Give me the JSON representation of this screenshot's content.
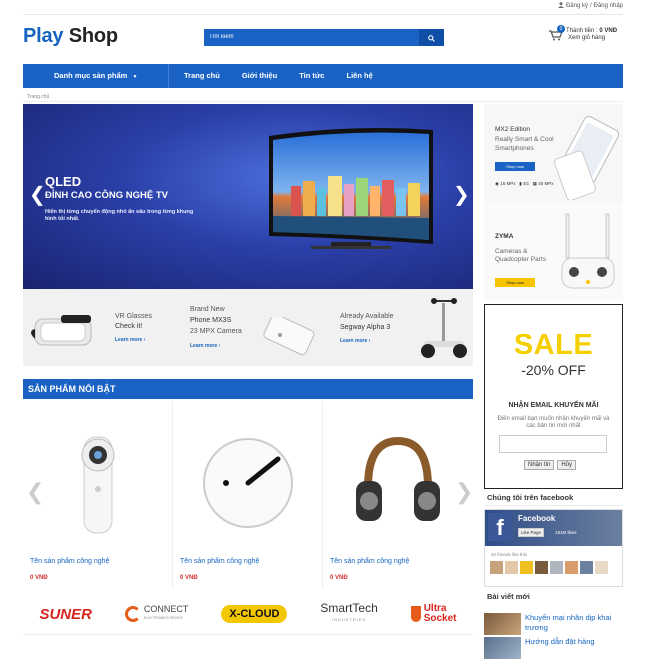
{
  "topbar": {
    "register": "Đăng ký",
    "separator": "/",
    "login": "Đăng nhập"
  },
  "logo": {
    "part1": "Play",
    "part2": "Shop"
  },
  "search": {
    "placeholder": "Tìm kiếm"
  },
  "cart": {
    "count": "0",
    "label": "Thành tiền :",
    "amount": "0 VNĐ",
    "view": "Xem giỏ hàng"
  },
  "nav": {
    "category": "Danh mục sản phẩm",
    "items": [
      "Trang chủ",
      "Giới thiệu",
      "Tin tức",
      "Liên hệ"
    ]
  },
  "breadcrumb": "Trang chủ",
  "hero": {
    "title": "QLED",
    "subtitle": "ĐỈNH CAO CÔNG NGHỆ TV",
    "desc": "Hiển thị từng chuyển động nhỏ ẩn sâu trong từng khung hình tối nhất.",
    "prev": "❮",
    "next": "❯"
  },
  "banners": [
    {
      "line1": "VR Glasses",
      "line2": "Check it!",
      "more": "Learn more ›"
    },
    {
      "line1": "Brand New",
      "line2": "Phone MX3S",
      "line3": "23 MPX Camera",
      "more": "Learn more ›"
    },
    {
      "line1": "Already Available",
      "line2": "Segway Alpha 3",
      "more": "Learn more ›"
    }
  ],
  "right_banners": [
    {
      "line1": "MX2 Edition",
      "line2": "Really Smart & Cool",
      "line3": "Smartphones",
      "button": "Shop now",
      "stat1": "16 MPx",
      "stat2": "4G",
      "stat3": "40 MPx"
    },
    {
      "line1": "ZYMA",
      "line2": "Cameras & Quadcopter Parts",
      "button": "Shop now"
    }
  ],
  "sale": {
    "big": "SALE",
    "percent": "-20% OFF",
    "heading": "NHẬN EMAIL KHUYẾN MÃI",
    "text": "Điền email bạn muốn nhận khuyến mãi và các bản tin mới nhất",
    "submit": "Nhận tin",
    "cancel": "Hủy"
  },
  "facebook": {
    "heading": "Chúng tôi trên facebook",
    "page_name": "Facebook",
    "like_button": "Like Page",
    "likes": "191M likes",
    "friends": "40 friends like this"
  },
  "posts": {
    "heading": "Bài viết mới",
    "items": [
      "Khuyến mại nhân dịp khai trương",
      "Hướng dẫn đặt hàng"
    ]
  },
  "featured": {
    "heading": "SẢN PHẨM NỔI BẬT",
    "products": [
      {
        "name": "Tên sản phẩm công nghệ",
        "price": "0 VNĐ"
      },
      {
        "name": "Tên sản phẩm công nghệ",
        "price": "0 VNĐ"
      },
      {
        "name": "Tên sản phẩm công nghệ",
        "price": "0 VNĐ"
      }
    ],
    "prev": "❮",
    "next": "❯"
  },
  "brands": [
    "SUNER",
    "CONNECT",
    "ELECTRONICS DEVICE",
    "X-CLOUD",
    "SmartTech",
    "INDUSTRIES",
    "Ultra",
    "Socket"
  ],
  "colors": {
    "primary": "#1a63c4",
    "sale_yellow": "#f5d000",
    "price_red": "#d32f2f"
  },
  "icons": [
    "user-icon",
    "search-icon",
    "cart-icon",
    "chevron-down-icon",
    "arrow-left-icon",
    "arrow-right-icon"
  ]
}
